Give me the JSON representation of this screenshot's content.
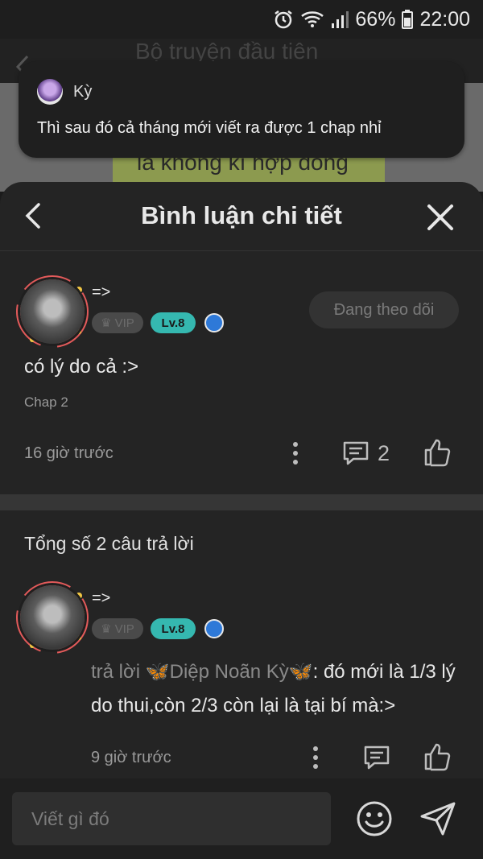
{
  "status_bar": {
    "battery": "66%",
    "time": "22:00"
  },
  "background_page": {
    "title": "Bộ truyện đầu tiên",
    "highlight_text": "là không kí hợp đồng"
  },
  "notification": {
    "sender": "Kỳ",
    "message": "Thì sau đó cả tháng mới viết ra được 1 chap nhỉ"
  },
  "sheet": {
    "title": "Bình luận chi tiết"
  },
  "comment": {
    "username": "=>",
    "vip_label": "VIP",
    "level": "Lv.8",
    "follow_label": "Đang theo dõi",
    "text": "có lý do cả :>",
    "chapter": "Chap 2",
    "time": "16 giờ trước",
    "reply_count": "2"
  },
  "replies": {
    "total_label": "Tổng số 2 câu trả lời",
    "items": [
      {
        "username": "=>",
        "vip_label": "VIP",
        "level": "Lv.8",
        "prefix": "trả lời ",
        "target": "Diệp Noãn Kỳ",
        "text": ": đó mới là 1/3 lý do thui,còn 2/3 còn lại là tại bí mà:>",
        "time": "9 giờ trước"
      }
    ]
  },
  "composer": {
    "placeholder": "Viết gì đó"
  },
  "colors": {
    "accent_level": "#35b8b0",
    "badge_blue": "#2e79d8",
    "butterfly": "#e08a2e"
  }
}
